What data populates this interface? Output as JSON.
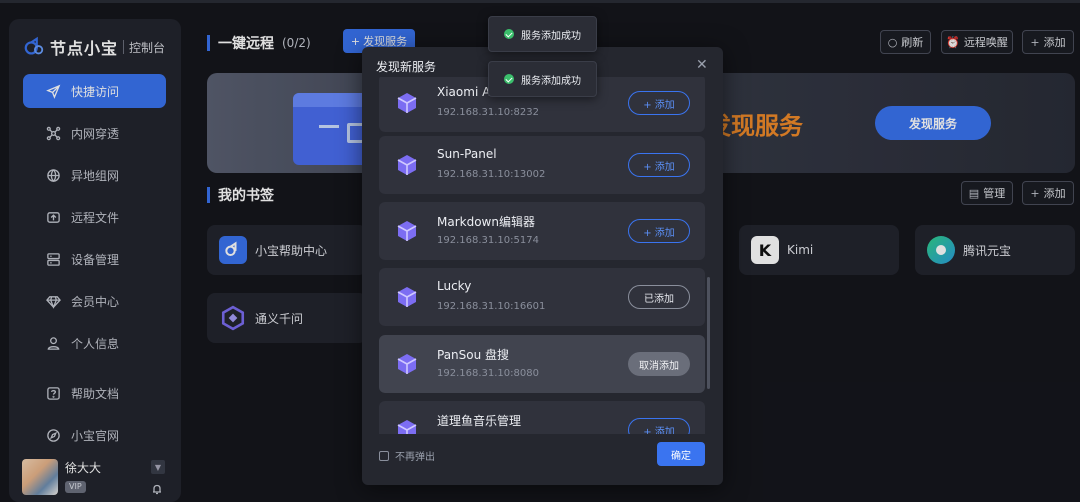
{
  "app": {
    "brand_name": "节点小宝",
    "brand_sub": "控制台"
  },
  "sidebar": {
    "items": [
      {
        "label": "快捷访问",
        "icon": "send-icon",
        "active": true
      },
      {
        "label": "内网穿透",
        "icon": "network-icon",
        "active": false
      },
      {
        "label": "异地组网",
        "icon": "globe-icon",
        "active": false
      },
      {
        "label": "远程文件",
        "icon": "upload-folder-icon",
        "active": false
      },
      {
        "label": "设备管理",
        "icon": "server-icon",
        "active": false
      },
      {
        "label": "会员中心",
        "icon": "diamond-icon",
        "active": false
      },
      {
        "label": "个人信息",
        "icon": "user-icon",
        "active": false
      },
      {
        "label": "帮助文档",
        "icon": "help-icon",
        "active": false
      },
      {
        "label": "小宝官网",
        "icon": "compass-icon",
        "active": false
      }
    ],
    "user": {
      "name": "徐大大",
      "badge": "VIP"
    }
  },
  "header": {
    "title": "一键远程",
    "count": "(0/2)",
    "discover_button": "发现服务",
    "refresh": "刷新",
    "wake": "远程唤醒",
    "add": "添加"
  },
  "banner": {
    "headline": "发现服务",
    "button": "发现服务"
  },
  "bookmarks": {
    "title": "我的书签",
    "manage": "管理",
    "add": "添加",
    "items": [
      "小宝帮助中心",
      "通义千问",
      "Kimi",
      "腾讯元宝"
    ]
  },
  "modal": {
    "title": "发现新服务",
    "services": [
      {
        "name": "Xiaomi AI",
        "addr": "192.168.31.10:8232",
        "action": "+ 添加",
        "state": "add"
      },
      {
        "name": "Sun-Panel",
        "addr": "192.168.31.10:13002",
        "action": "+ 添加",
        "state": "add"
      },
      {
        "name": "Markdown编辑器",
        "addr": "192.168.31.10:5174",
        "action": "+ 添加",
        "state": "add"
      },
      {
        "name": "Lucky",
        "addr": "192.168.31.10:16601",
        "action": "已添加",
        "state": "added"
      },
      {
        "name": "PanSou 盘搜",
        "addr": "192.168.31.10:8080",
        "action": "取消添加",
        "state": "cancel"
      },
      {
        "name": "道理鱼音乐管理",
        "addr": "",
        "action": "+ 添加",
        "state": "add"
      }
    ],
    "dont_show": "不再弹出",
    "confirm": "确定"
  },
  "toasts": [
    "服务添加成功",
    "服务添加成功"
  ],
  "colors": {
    "accent": "#3a74f0",
    "success": "#3bbf6c",
    "banner_highlight": "#f08a2a"
  }
}
